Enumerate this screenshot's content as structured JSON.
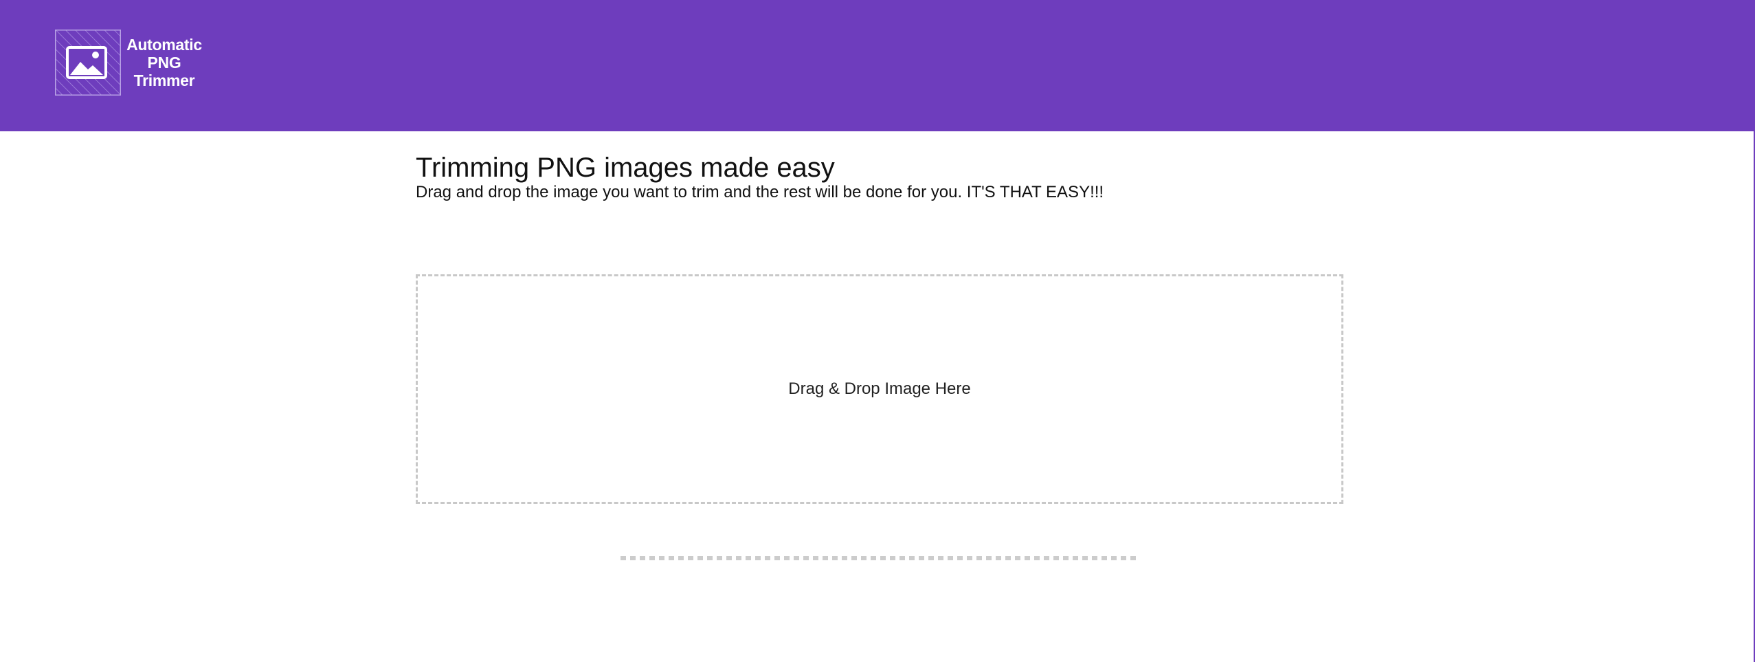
{
  "header": {
    "background_color": "#6e3dbd",
    "logo": {
      "icon": "image-icon",
      "lines": [
        "Automatic",
        "PNG",
        "Trimmer"
      ]
    }
  },
  "main": {
    "title": "Trimming PNG images made easy",
    "subtitle": "Drag and drop the image you want to trim and the rest will be done for you. IT'S THAT EASY!!!",
    "dropzone": {
      "label": "Drag & Drop Image Here",
      "border_color": "#c8c8c8"
    }
  }
}
